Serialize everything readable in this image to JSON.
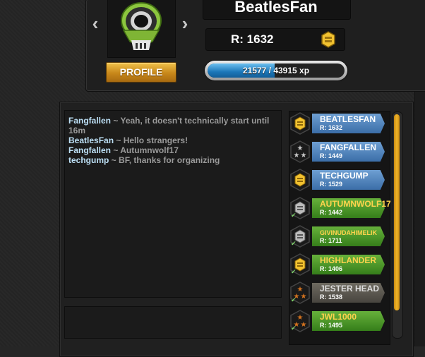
{
  "profile": {
    "username": "BeatlesFan",
    "rating": "R: 1632",
    "xp_text": "21577 / 43915 xp",
    "xp_fraction": 0.491,
    "profile_button": "PROFILE",
    "prev_icon": "chevron-left-icon",
    "next_icon": "chevron-right-icon",
    "avatar_icon": "alien-skull-icon",
    "rank_icon": "gold-hexagon-icon"
  },
  "chat": {
    "messages": [
      {
        "sender": "Fangfallen",
        "sep": "~",
        "text": "Yeah, it doesn't technically start until 16m"
      },
      {
        "sender": "BeatlesFan",
        "sep": "~",
        "text": "Hello strangers!"
      },
      {
        "sender": "Fangfallen",
        "sep": "~",
        "text": "Autumnwolf17"
      },
      {
        "sender": "techgump",
        "sep": "~",
        "text": "BF, thanks for organizing"
      }
    ]
  },
  "players": [
    {
      "name": "BEATLESFAN",
      "rating": "R: 1632",
      "style": "blue",
      "icon": "gold-hexagon-icon",
      "checked": false
    },
    {
      "name": "FANGFALLEN",
      "rating": "R: 1449",
      "style": "blue",
      "icon": "silver-stars-icon",
      "checked": false
    },
    {
      "name": "TECHGUMP",
      "rating": "R: 1529",
      "style": "blue",
      "icon": "gold-hexagon-icon",
      "checked": false
    },
    {
      "name": "AUTUMNWOLF17",
      "rating": "R: 1442",
      "style": "green",
      "icon": "silver-hexagon-icon",
      "checked": true
    },
    {
      "name": "GIVINUDAHIMELIK",
      "rating": "R: 1711",
      "style": "green",
      "icon": "silver-hexagon-icon",
      "checked": true
    },
    {
      "name": "HIGHLANDER",
      "rating": "R: 1406",
      "style": "green",
      "icon": "gold-hexagon-icon",
      "checked": true
    },
    {
      "name": "JESTER HEAD",
      "rating": "R: 1538",
      "style": "grey",
      "icon": "bronze-stars-icon",
      "checked": true
    },
    {
      "name": "JWL1000",
      "rating": "R: 1495",
      "style": "green",
      "icon": "bronze-stars-icon",
      "checked": true
    }
  ],
  "colors": {
    "accent_gold": "#f0b428",
    "xp_blue": "#1b76b8",
    "ready_green": "#357e1a",
    "waiting_blue": "#3b6ea8"
  }
}
